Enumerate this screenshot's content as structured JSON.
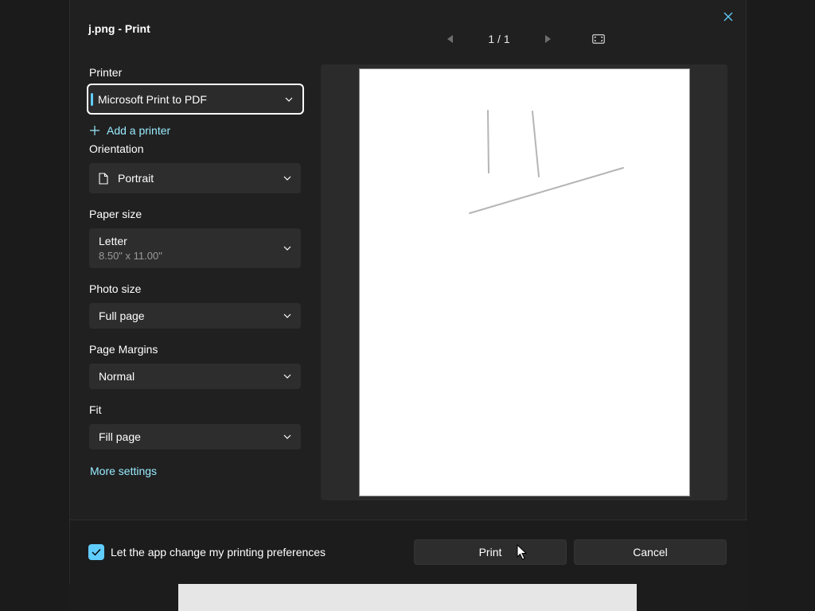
{
  "window": {
    "title": "j.png - Print"
  },
  "preview_nav": {
    "page_counter": "1 / 1"
  },
  "printer": {
    "label": "Printer",
    "value": "Microsoft Print to PDF",
    "add_printer": "Add a printer"
  },
  "orientation": {
    "label": "Orientation",
    "value": "Portrait"
  },
  "paper_size": {
    "label": "Paper size",
    "value": "Letter",
    "sub": "8.50\" x 11.00\""
  },
  "photo_size": {
    "label": "Photo size",
    "value": "Full page"
  },
  "page_margins": {
    "label": "Page Margins",
    "value": "Normal"
  },
  "fit": {
    "label": "Fit",
    "value": "Fill page"
  },
  "more_settings": "More settings",
  "footer": {
    "checkbox_label": "Let the app change my printing preferences",
    "checkbox_checked": true,
    "print_label": "Print",
    "cancel_label": "Cancel"
  },
  "colors": {
    "accent": "#60cdff",
    "link": "#99ebff",
    "dialog_bg": "#202020",
    "control_bg": "#2d2d2d"
  },
  "icons": {
    "close": "close-icon",
    "prev": "triangle-left-icon",
    "next": "triangle-right-icon",
    "fit": "fit-to-window-icon",
    "add": "plus-icon",
    "orientation": "document-icon",
    "chevron": "chevron-down-icon",
    "check": "checkmark-icon"
  }
}
